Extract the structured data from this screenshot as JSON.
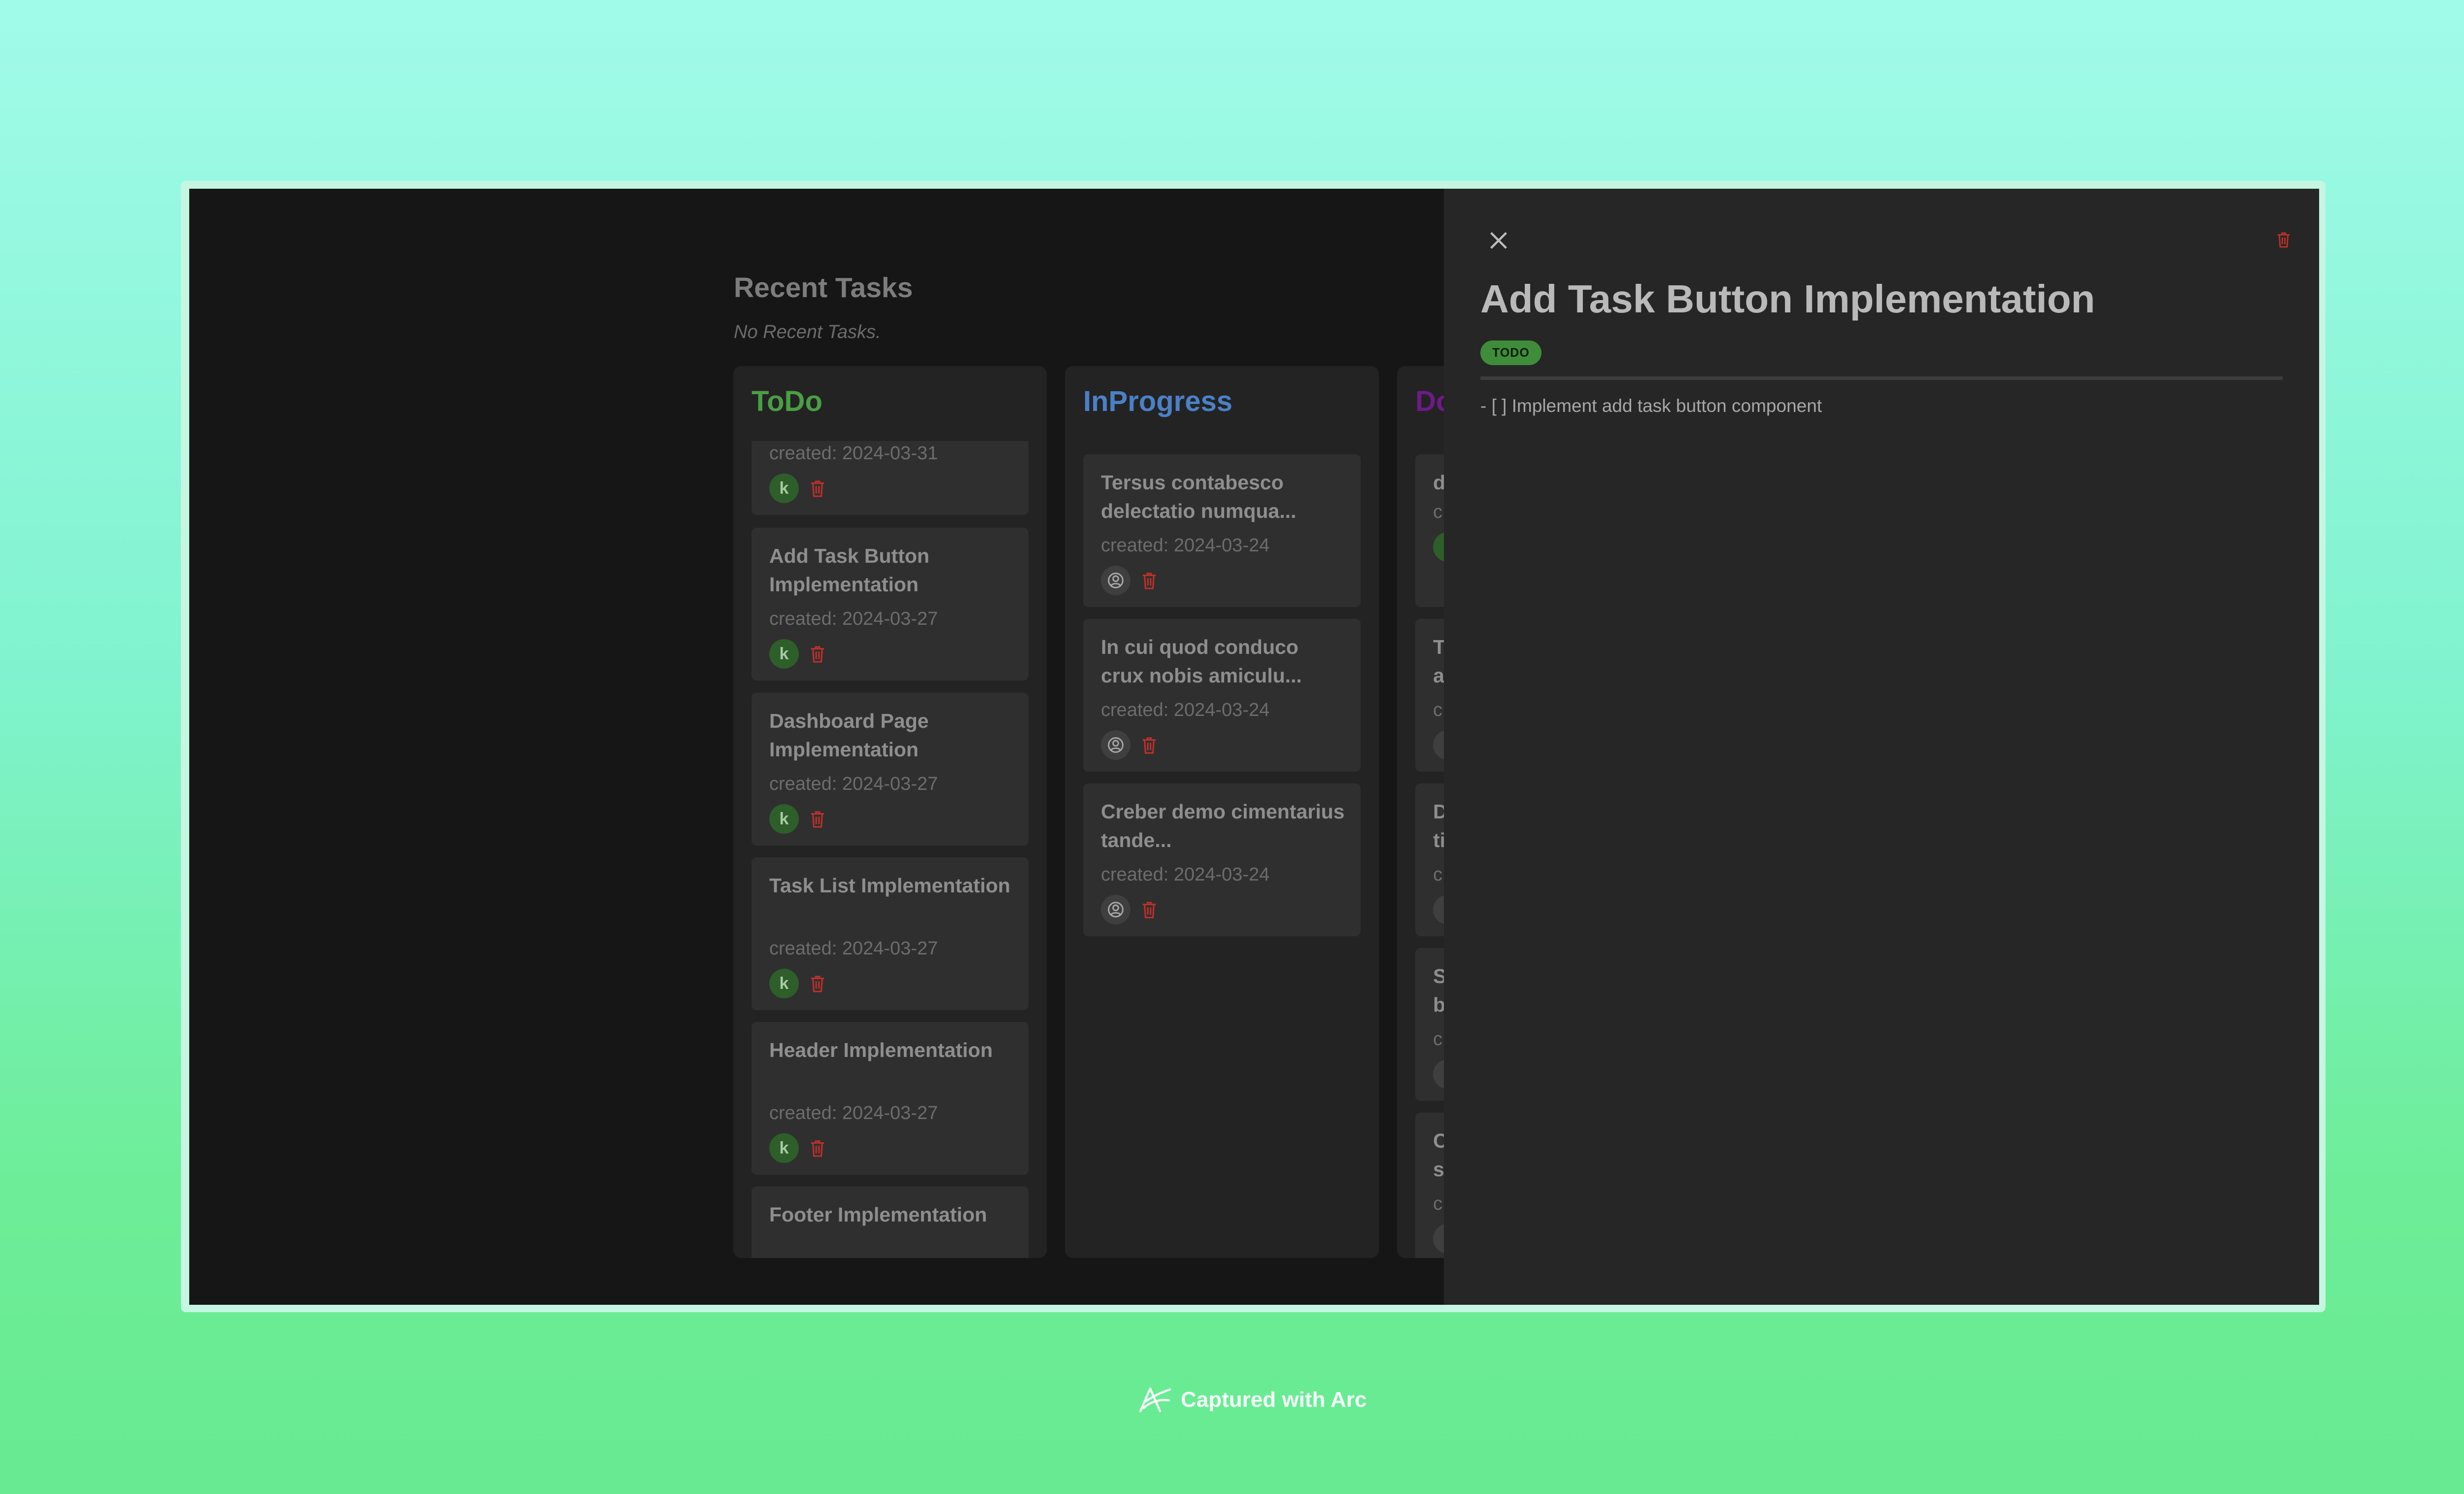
{
  "recent": {
    "title": "Recent Tasks",
    "empty_text": "No Recent Tasks."
  },
  "columns": [
    {
      "title": "ToDo",
      "color": "#4a9e44",
      "cards": [
        {
          "title": "",
          "created": "created: 2024-03-31",
          "assignee": "k"
        },
        {
          "title": "Add Task Button Implementation",
          "created": "created: 2024-03-27",
          "assignee": "k"
        },
        {
          "title": "Dashboard Page Implementation",
          "created": "created: 2024-03-27",
          "assignee": "k"
        },
        {
          "title": "Task List Implementation",
          "created": "created: 2024-03-27",
          "assignee": "k"
        },
        {
          "title": "Header Implementation",
          "created": "created: 2024-03-27",
          "assignee": "k"
        },
        {
          "title": "Footer Implementation",
          "created": "",
          "assignee": ""
        }
      ]
    },
    {
      "title": "InProgress",
      "color": "#4b80c6",
      "cards": [
        {
          "title": "Tersus contabesco delectatio numqua...",
          "created": "created: 2024-03-24",
          "assignee": ""
        },
        {
          "title": "In cui quod conduco crux nobis amiculu...",
          "created": "created: 2024-03-24",
          "assignee": ""
        },
        {
          "title": "Creber demo cimentarius tande...",
          "created": "created: 2024-03-24",
          "assignee": ""
        }
      ]
    },
    {
      "title": "Do",
      "color": "#6d1a86",
      "cards": [
        {
          "title": "d",
          "created": "c",
          "assignee": ""
        },
        {
          "title": "T a",
          "created": "c",
          "assignee": ""
        },
        {
          "title": "D ti",
          "created": "c",
          "assignee": ""
        },
        {
          "title": "S b",
          "created": "c",
          "assignee": ""
        },
        {
          "title": "C s",
          "created": "c",
          "assignee": ""
        }
      ]
    }
  ],
  "detail": {
    "title": "Add Task Button Implementation",
    "status": "TODO",
    "description": "- [ ] Implement add task button component"
  },
  "footer": {
    "caption": "Captured with Arc"
  },
  "colors": {
    "delete_red": "#c0302b",
    "status_green": "#3f8d3a"
  }
}
